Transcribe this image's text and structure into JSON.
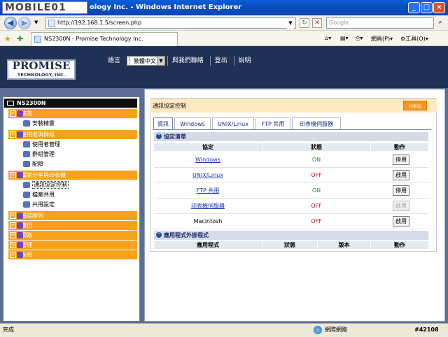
{
  "window": {
    "logo_text": "MOBILE01",
    "title": "ology Inc. - Windows Internet Explorer"
  },
  "address": {
    "url": "http://192.168.1.5/screen.php",
    "search_placeholder": "Google"
  },
  "browser_tab": {
    "title": "NS2300N - Promise Technology Inc."
  },
  "toolbar": {
    "page_label": "網頁(P)",
    "tools_label": "工具(O)"
  },
  "brand": {
    "name": "PROMISE",
    "sub": "TECHNOLOGY, INC."
  },
  "topnav": {
    "language_label": "語言",
    "language_value": "繁體中文",
    "contact": "與我們聯絡",
    "logout": "登出",
    "help": "說明"
  },
  "tree": {
    "root": "NS2300N",
    "items": [
      {
        "type": "node",
        "label": "裝置"
      },
      {
        "type": "sub",
        "label": "安裝精靈"
      },
      {
        "type": "node",
        "label": "使用者與群組"
      },
      {
        "type": "sub",
        "label": "使用者管理"
      },
      {
        "type": "sub",
        "label": "群組管理"
      },
      {
        "type": "sub",
        "label": "配額"
      },
      {
        "type": "node",
        "label": "檔案分享與印表機"
      },
      {
        "type": "sub",
        "label": "通訊協定控制",
        "selected": true
      },
      {
        "type": "sub",
        "label": "檔案共用"
      },
      {
        "type": "sub",
        "label": "共用設定"
      },
      {
        "type": "node",
        "label": "磁碟陣列"
      },
      {
        "type": "node",
        "label": "備份"
      },
      {
        "type": "node",
        "label": "網路"
      },
      {
        "type": "node",
        "label": "管理"
      },
      {
        "type": "node",
        "label": "系統"
      }
    ]
  },
  "content": {
    "title": "通訊協定控制",
    "help_button": "Help",
    "tabs": [
      "資訊",
      "Windows",
      "UNIX/Linux",
      "FTP 共用",
      "印表機伺服器"
    ],
    "protocol_section": "協定清單",
    "columns": [
      "協定",
      "狀態",
      "動作"
    ],
    "rows": [
      {
        "service": "Windows",
        "status": "ON",
        "action": "停用",
        "link": true
      },
      {
        "service": "UNIX/Linux",
        "status": "OFF",
        "action": "啟用",
        "link": true
      },
      {
        "service": "FTP 共用",
        "status": "ON",
        "action": "停用",
        "link": true
      },
      {
        "service": "印表機伺服器",
        "status": "OFF",
        "action": "啟用",
        "link": true,
        "disabled": true
      },
      {
        "service": "Macintosh",
        "status": "OFF",
        "action": "啟用",
        "link": false
      }
    ],
    "plugin_section": "應用程式外掛程式",
    "plugin_columns": [
      "應用程式",
      "狀態",
      "版本",
      "動作"
    ]
  },
  "statusbar": {
    "left": "完成",
    "zone": "網際網路",
    "zoom": "#42108"
  },
  "colors": {
    "header_bg": "#1f3154",
    "tree_node": "#f7a21a",
    "status_on": "#1b9a2b",
    "status_off": "#d20e0e",
    "help_btn": "#f7961e"
  }
}
